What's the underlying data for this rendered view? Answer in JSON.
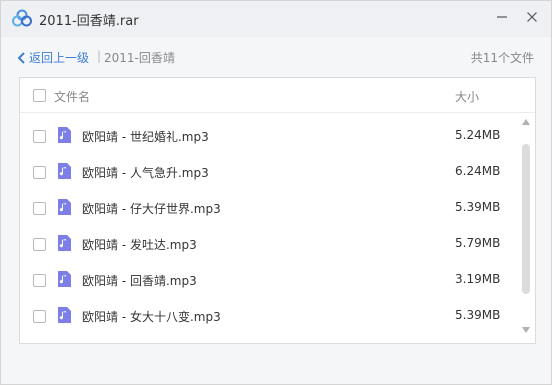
{
  "window": {
    "title": "2011-回香靖.rar"
  },
  "nav": {
    "back_label": "返回上一级",
    "separator": "|",
    "current_folder": "2011-回香靖",
    "file_count": "共11个文件"
  },
  "list": {
    "header": {
      "name": "文件名",
      "size": "大小"
    },
    "files": [
      {
        "name": "欧阳靖 - 世纪婚礼.mp3",
        "size": "5.24MB"
      },
      {
        "name": "欧阳靖 - 人气急升.mp3",
        "size": "6.24MB"
      },
      {
        "name": "欧阳靖 - 仔大仔世界.mp3",
        "size": "5.39MB"
      },
      {
        "name": "欧阳靖 - 发吐达.mp3",
        "size": "5.79MB"
      },
      {
        "name": "欧阳靖 - 回香靖.mp3",
        "size": "3.19MB"
      },
      {
        "name": "欧阳靖 - 女大十八变.mp3",
        "size": "5.39MB"
      }
    ]
  },
  "colors": {
    "accent": "#3d7fd6",
    "music_icon": "#7b7fe6",
    "titlebar": "#eef0f3"
  },
  "icons": {
    "app": "cloud-logo-icon",
    "file": "music-file-icon",
    "back": "chevron-left-icon",
    "minimize": "minimize-icon",
    "close": "close-icon"
  }
}
